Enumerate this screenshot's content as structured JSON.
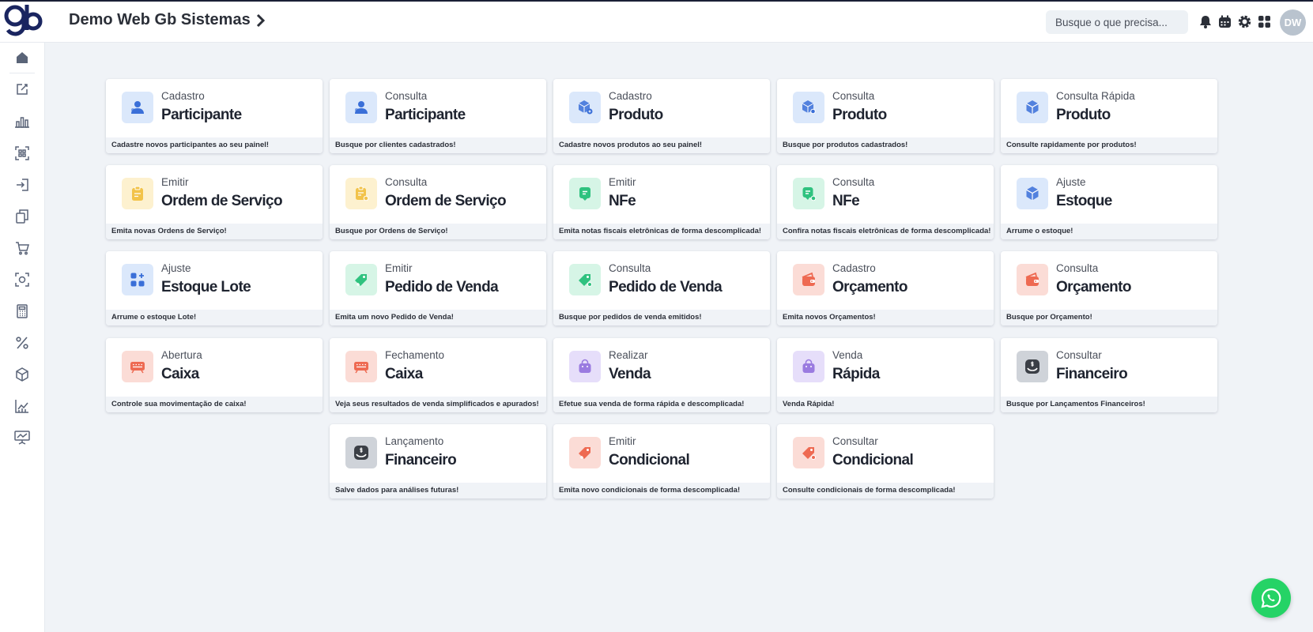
{
  "header": {
    "title": "Demo Web Gb Sistemas",
    "search_placeholder": "Busque o que precisa...",
    "user_initials": "DW"
  },
  "colors": {
    "blue_bg": "#dbe8fb",
    "blue_fg": "#3a6fd8",
    "yellow_bg": "#fdf1cf",
    "yellow_fg": "#f2c34a",
    "green_bg": "#d6f5e6",
    "green_fg": "#2fc27f",
    "red_bg": "#fbdcd6",
    "red_fg": "#ee6a52",
    "purple_bg": "#e6defa",
    "purple_fg": "#9a7be0",
    "gray_bg": "#cfd3d9",
    "gray_fg": "#3b3f46"
  },
  "sidebar": {
    "items": [
      "home-icon",
      "edit-icon",
      "bar-chart-icon",
      "qr-scan-icon",
      "login-icon",
      "copy-icon",
      "cart-icon",
      "scan-icon",
      "calculator-icon",
      "percent-icon",
      "box-icon",
      "line-chart-icon",
      "presentation-icon"
    ]
  },
  "cards": [
    {
      "sub": "Cadastro",
      "title": "Participante",
      "desc": "Cadastre novos participantes ao seu painel!",
      "icon": "user-icon",
      "color": "blue"
    },
    {
      "sub": "Consulta",
      "title": "Participante",
      "desc": "Busque por clientes cadastrados!",
      "icon": "user-icon",
      "color": "blue"
    },
    {
      "sub": "Cadastro",
      "title": "Produto",
      "desc": "Cadastre novos produtos ao seu painel!",
      "icon": "cube-plus-icon",
      "color": "blue"
    },
    {
      "sub": "Consulta",
      "title": "Produto",
      "desc": "Busque por produtos cadastrados!",
      "icon": "cube-search-icon",
      "color": "blue"
    },
    {
      "sub": "Consulta Rápida",
      "title": "Produto",
      "desc": "Consulte rapidamente por produtos!",
      "icon": "cube-icon",
      "color": "blue"
    },
    {
      "sub": "Emitir",
      "title": "Ordem de Serviço",
      "desc": "Emita novas Ordens de Serviço!",
      "icon": "clipboard-icon",
      "color": "yellow"
    },
    {
      "sub": "Consulta",
      "title": "Ordem de Serviço",
      "desc": "Busque por Ordens de Serviço!",
      "icon": "clipboard-search-icon",
      "color": "yellow"
    },
    {
      "sub": "Emitir",
      "title": "NFe",
      "desc": "Emita notas fiscais eletrônicas de forma descomplicada!",
      "icon": "invoice-icon",
      "color": "green"
    },
    {
      "sub": "Consulta",
      "title": "NFe",
      "desc": "Confira notas fiscais eletrônicas de forma descomplicada!",
      "icon": "invoice-search-icon",
      "color": "green"
    },
    {
      "sub": "Ajuste",
      "title": "Estoque",
      "desc": "Arrume o estoque!",
      "icon": "cube-icon",
      "color": "blue"
    },
    {
      "sub": "Ajuste",
      "title": "Estoque Lote",
      "desc": "Arrume o estoque Lote!",
      "icon": "grid-plus-icon",
      "color": "blue"
    },
    {
      "sub": "Emitir",
      "title": "Pedido de Venda",
      "desc": "Emita um novo Pedido de Venda!",
      "icon": "tag-plus-icon",
      "color": "green"
    },
    {
      "sub": "Consulta",
      "title": "Pedido de Venda",
      "desc": "Busque por pedidos de venda emitidos!",
      "icon": "tag-icon",
      "color": "green"
    },
    {
      "sub": "Cadastro",
      "title": "Orçamento",
      "desc": "Emita novos Orçamentos!",
      "icon": "wallet-icon",
      "color": "red"
    },
    {
      "sub": "Consulta",
      "title": "Orçamento",
      "desc": "Busque por Orçamento!",
      "icon": "wallet-icon",
      "color": "red"
    },
    {
      "sub": "Abertura",
      "title": "Caixa",
      "desc": "Controle sua movimentação de caixa!",
      "icon": "register-icon",
      "color": "red"
    },
    {
      "sub": "Fechamento",
      "title": "Caixa",
      "desc": "Veja seus resultados de venda simplificados e apurados!",
      "icon": "register-icon",
      "color": "red"
    },
    {
      "sub": "Realizar",
      "title": "Venda",
      "desc": "Efetue sua venda de forma rápida e descomplicada!",
      "icon": "bag-icon",
      "color": "purple"
    },
    {
      "sub": "Venda",
      "title": "Rápida",
      "desc": "Venda Rápida!",
      "icon": "bag-icon",
      "color": "purple"
    },
    {
      "sub": "Consultar",
      "title": "Financeiro",
      "desc": "Busque por Lançamentos Financeiros!",
      "icon": "money-icon",
      "color": "gray"
    },
    {
      "sub": "Lançamento",
      "title": "Financeiro",
      "desc": "Salve dados para análises futuras!",
      "icon": "money-icon",
      "color": "gray"
    },
    {
      "sub": "Emitir",
      "title": "Condicional",
      "desc": "Emita novo condicionais de forma descomplicada!",
      "icon": "tag-plus-icon",
      "color": "red"
    },
    {
      "sub": "Consultar",
      "title": "Condicional",
      "desc": "Consulte condicionais de forma descomplicada!",
      "icon": "tag-icon",
      "color": "red"
    }
  ]
}
